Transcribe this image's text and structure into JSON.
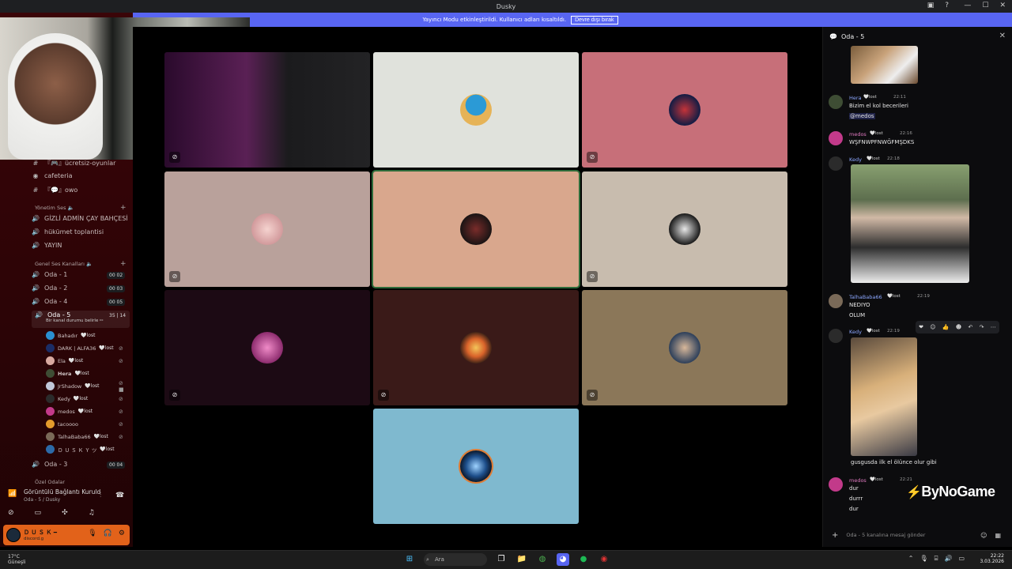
{
  "window": {
    "title": "Dusky"
  },
  "banner": {
    "text": "Yayıncı Modu etkinleştirildi. Kullanıcı adları kısaltıldı.",
    "button": "Devre dışı bırak"
  },
  "sidebar": {
    "channels_top": [
      {
        "icon": "hash-icon",
        "label": "『🎮』ücretsiz-oyunlar"
      },
      {
        "icon": "forum-icon",
        "label": "cafeteria"
      },
      {
        "icon": "hash-icon",
        "label": "『💬』owo"
      }
    ],
    "section_admin": "Yönetim Ses 🔈",
    "admin_channels": [
      "GİZLİ ADMİN ÇAY BAHÇESİ",
      "hükümet toplantisi",
      "YAYIN"
    ],
    "section_general": "Genel Ses Kanalları 🔈",
    "voice_channels": [
      {
        "label": "Oda - 1",
        "badge": "00 02"
      },
      {
        "label": "Oda - 2",
        "badge": "00 03"
      },
      {
        "label": "Oda - 4",
        "badge": "00 05"
      }
    ],
    "active_channel": {
      "label": "Oda - 5",
      "badge": "35 | 14",
      "status": "Bir kanal durumu belirle ✏"
    },
    "members": [
      {
        "name": "Bahadır",
        "tag": "🤍lost"
      },
      {
        "name": "DARK | ALFA36",
        "tag": "🤍lost"
      },
      {
        "name": "Ela",
        "tag": "🤍lost"
      },
      {
        "name": "Hera",
        "tag": "🤍lost"
      },
      {
        "name": "JrShadow",
        "tag": "🤍lost"
      },
      {
        "name": "Kedy",
        "tag": "🤍lost"
      },
      {
        "name": "medos",
        "tag": "🤍lost"
      },
      {
        "name": "tacoooo",
        "tag": ""
      },
      {
        "name": "TalhaBaba66",
        "tag": "🤍lost"
      },
      {
        "name": "Ｄ Ｕ Ｓ Ｋ Ｙ ツ",
        "tag": "🤍lost"
      }
    ],
    "after_channel": {
      "label": "Oda - 3",
      "badge": "00 04"
    },
    "section_private": "Özel Odalar"
  },
  "voice_status": {
    "title": "Görüntülü Bağlantı Kuruld",
    "subtitle": "Oda - 5 / Dusky"
  },
  "user": {
    "name": "Ｄ Ｕ Ｓ Ｋ ━",
    "sub": "discord.g"
  },
  "chat": {
    "header": "Oda - 5",
    "messages": [
      {
        "name": "Hera",
        "tag": "🤍lost",
        "time": "22:11",
        "lines": [
          "Bizim el kol becerileri"
        ],
        "mention": "@medos"
      },
      {
        "name": "medos",
        "tag": "🤍lost",
        "time": "22:16",
        "lines": [
          "WŞFNWPFNWĞFMŞDKS"
        ]
      },
      {
        "name": "Kedy",
        "tag": "🤍lost",
        "time": "22:18",
        "lines": []
      },
      {
        "name": "TalhaBaba66",
        "tag": "🤍lost",
        "time": "22:19",
        "lines": [
          "NEDIYO",
          "OLUM"
        ]
      },
      {
        "name": "Kedy",
        "tag": "🤍lost",
        "time": "22:19",
        "lines": [
          "gusgusda ilk el ölünce olur gibi"
        ]
      },
      {
        "name": "medos",
        "tag": "🤍lost",
        "time": "22:21",
        "lines": [
          "dur",
          "durrr",
          "dur"
        ]
      }
    ],
    "input_placeholder": "Oda - 5 kanalına mesaj gönder"
  },
  "watermark": "ByNoGame",
  "taskbar": {
    "weather_temp": "17°C",
    "weather_desc": "Güneşli",
    "search_placeholder": "Ara",
    "time": "22:22",
    "date": "3.03.2026"
  },
  "colors": {
    "blurple": "#5865f2",
    "user_bar": "#e2621a",
    "sidebar": "#3a0508"
  }
}
